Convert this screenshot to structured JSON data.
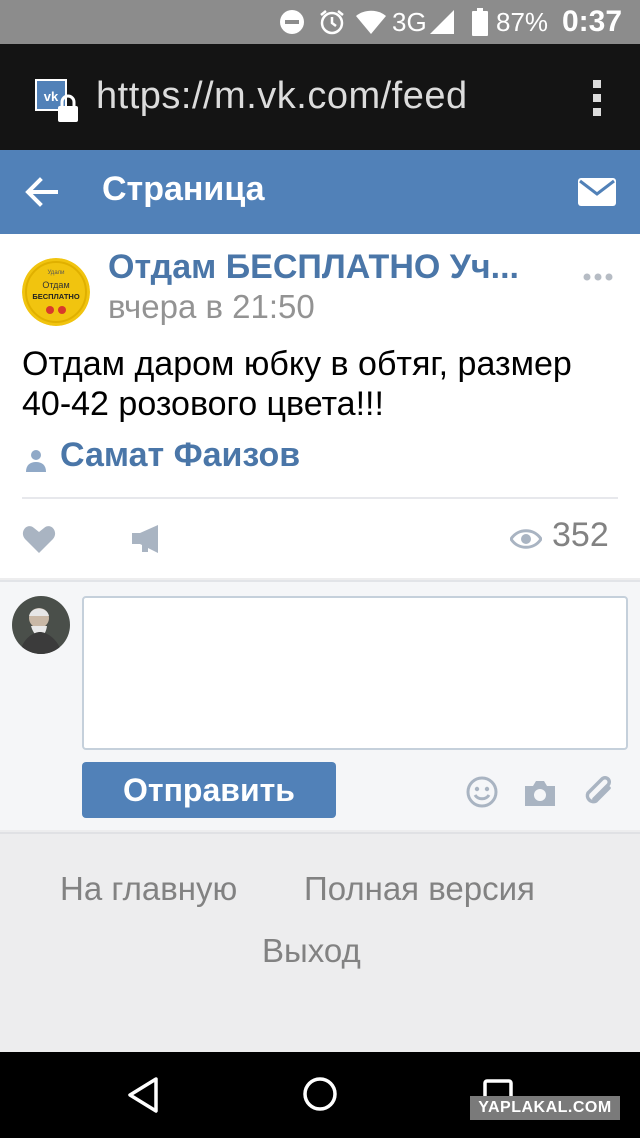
{
  "status_bar": {
    "network": "3G",
    "battery_percent": "87%",
    "time": "0:37",
    "icons": [
      "do-not-disturb-icon",
      "alarm-icon",
      "wifi-icon",
      "signal-icon",
      "battery-icon"
    ]
  },
  "browser": {
    "url": "https://m.vk.com/feed",
    "icons": [
      "vk-secure-site-icon",
      "overflow-menu-icon"
    ]
  },
  "header": {
    "title": "Страница",
    "icons": [
      "back-arrow-icon",
      "mail-icon"
    ]
  },
  "post": {
    "avatar_text_top": "Удали",
    "avatar_text_1": "Отдам",
    "avatar_text_2": "БЕСПЛАТНО",
    "author": "Отдам БЕСПЛАТНО Уч...",
    "time": "вчера в 21:50",
    "text": "Отдам даром юбку в обтяг, размер 40-42 розового цвета!!!",
    "signer": "Самат Фаизов",
    "views": "352",
    "icons": [
      "more-icon",
      "user-icon",
      "like-icon",
      "share-icon",
      "views-icon"
    ]
  },
  "comment": {
    "input_value": "",
    "send_label": "Отправить",
    "icons": [
      "smile-icon",
      "camera-icon",
      "attach-icon"
    ]
  },
  "footer": {
    "home": "На главную",
    "full_version": "Полная версия",
    "logout": "Выход"
  },
  "navbar": {
    "icons": [
      "nav-back-icon",
      "nav-home-icon",
      "nav-recent-icon"
    ]
  },
  "watermark": "YAPLAKAL.COM",
  "colors": {
    "vk_blue": "#5181b8",
    "link_blue": "#4a76a8",
    "status_bar": "#8c8c8c",
    "url_bar": "#141414"
  }
}
